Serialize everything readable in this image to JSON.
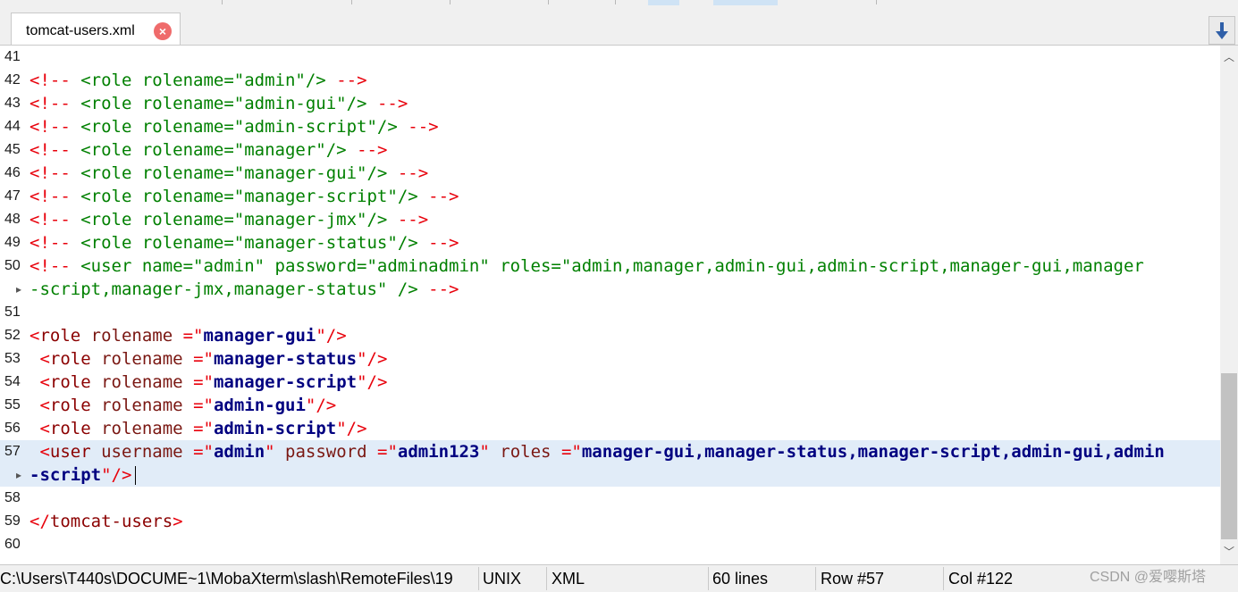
{
  "tab": {
    "title": "tomcat-users.xml",
    "close_symbol": "×"
  },
  "lines": [
    {
      "n": "41",
      "html": ""
    },
    {
      "n": "42",
      "html": "<span class='punc'>&lt;!--</span><span class='cmt'> &lt;role rolename=\"admin\"/&gt; </span><span class='punc'>--&gt;</span>"
    },
    {
      "n": "43",
      "html": "<span class='punc'>&lt;!--</span><span class='cmt'> &lt;role rolename=\"admin-gui\"/&gt; </span><span class='punc'>--&gt;</span>"
    },
    {
      "n": "44",
      "html": "<span class='punc'>&lt;!--</span><span class='cmt'> &lt;role rolename=\"admin-script\"/&gt; </span><span class='punc'>--&gt;</span>"
    },
    {
      "n": "45",
      "html": "<span class='punc'>&lt;!--</span><span class='cmt'> &lt;role rolename=\"manager\"/&gt; </span><span class='punc'>--&gt;</span>"
    },
    {
      "n": "46",
      "html": "<span class='punc'>&lt;!--</span><span class='cmt'> &lt;role rolename=\"manager-gui\"/&gt; </span><span class='punc'>--&gt;</span>"
    },
    {
      "n": "47",
      "html": "<span class='punc'>&lt;!--</span><span class='cmt'> &lt;role rolename=\"manager-script\"/&gt; </span><span class='punc'>--&gt;</span>"
    },
    {
      "n": "48",
      "html": "<span class='punc'>&lt;!--</span><span class='cmt'> &lt;role rolename=\"manager-jmx\"/&gt; </span><span class='punc'>--&gt;</span>"
    },
    {
      "n": "49",
      "html": "<span class='punc'>&lt;!--</span><span class='cmt'> &lt;role rolename=\"manager-status\"/&gt; </span><span class='punc'>--&gt;</span>"
    },
    {
      "n": "50",
      "html": "<span class='punc'>&lt;!--</span><span class='cmt'> &lt;user name=\"admin\" password=\"adminadmin\" roles=\"admin,manager,admin-gui,admin-script,manager-gui,manager</span>"
    },
    {
      "n": "",
      "wrap": true,
      "html": "<span class='cmt'>-script,manager-jmx,manager-status\" /&gt; </span><span class='punc'>--&gt;</span>"
    },
    {
      "n": "51",
      "html": ""
    },
    {
      "n": "52",
      "html": "<span class='punc'>&lt;</span><span class='tag'>role</span><span class='attr'> rolename </span><span class='punc'>=\"</span><span class='val'>manager-gui</span><span class='punc'>\"/&gt;</span>"
    },
    {
      "n": "53",
      "html": " <span class='punc'>&lt;</span><span class='tag'>role</span><span class='attr'> rolename </span><span class='punc'>=\"</span><span class='val'>manager-status</span><span class='punc'>\"/&gt;</span>"
    },
    {
      "n": "54",
      "html": " <span class='punc'>&lt;</span><span class='tag'>role</span><span class='attr'> rolename </span><span class='punc'>=\"</span><span class='val'>manager-script</span><span class='punc'>\"/&gt;</span>"
    },
    {
      "n": "55",
      "html": " <span class='punc'>&lt;</span><span class='tag'>role</span><span class='attr'> rolename </span><span class='punc'>=\"</span><span class='val'>admin-gui</span><span class='punc'>\"/&gt;</span>"
    },
    {
      "n": "56",
      "html": " <span class='punc'>&lt;</span><span class='tag'>role</span><span class='attr'> rolename </span><span class='punc'>=\"</span><span class='val'>admin-script</span><span class='punc'>\"/&gt;</span>"
    },
    {
      "n": "57",
      "hl": true,
      "html": " <span class='punc'>&lt;</span><span class='tag'>user</span><span class='attr'> username </span><span class='punc'>=\"</span><span class='val'>admin</span><span class='punc'>\"</span><span class='attr'> password </span><span class='punc'>=\"</span><span class='val'>admin123</span><span class='punc'>\"</span><span class='attr'> roles </span><span class='punc'>=\"</span><span class='val'>manager-gui,manager-status,manager-script,admin-gui,admin</span>"
    },
    {
      "n": "",
      "wrap": true,
      "hl": true,
      "caret": true,
      "html": "<span class='val'>-script</span><span class='punc'>\"/&gt;</span>"
    },
    {
      "n": "58",
      "html": ""
    },
    {
      "n": "59",
      "html": "<span class='punc'>&lt;/</span><span class='tag'>tomcat-users</span><span class='punc'>&gt;</span>"
    },
    {
      "n": "60",
      "html": ""
    }
  ],
  "status": {
    "path": "C:\\Users\\T440s\\DOCUME~1\\MobaXterm\\slash\\RemoteFiles\\19",
    "eol": "UNIX",
    "syntax": "XML",
    "line_count": "60 lines",
    "row": "Row #57",
    "col": "Col #122"
  },
  "watermark": "CSDN @爱嘤斯塔",
  "colors": {
    "punctuation": "#e8000b",
    "comment": "#008000",
    "tag": "#8b0000",
    "attribute": "#7a1712",
    "value": "#000080",
    "current_line": "#e1ecf8"
  },
  "icons": {
    "tab_close": "close-circle-icon",
    "scroll_to_end": "arrow-down-icon",
    "wrap": "wrap-arrow-icon"
  }
}
